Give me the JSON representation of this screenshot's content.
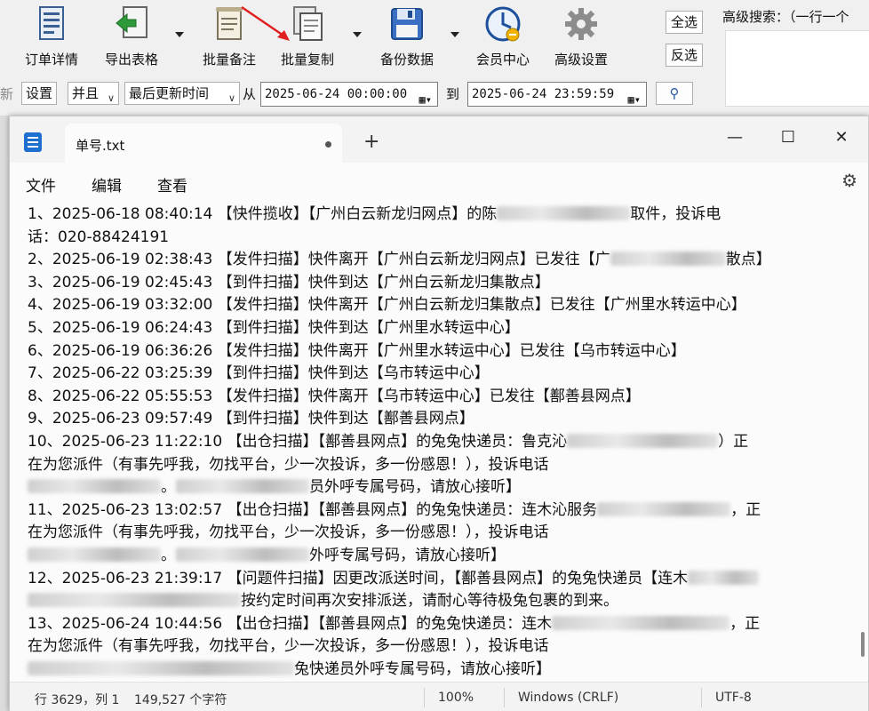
{
  "toolbar": {
    "buttons": [
      {
        "label": "订单详情",
        "icon": "order-detail-icon"
      },
      {
        "label": "导出表格",
        "icon": "export-table-icon"
      },
      {
        "label": "批量备注",
        "icon": "batch-note-icon"
      },
      {
        "label": "批量复制",
        "icon": "batch-copy-icon"
      },
      {
        "label": "备份数据",
        "icon": "backup-disk-icon"
      },
      {
        "label": "会员中心",
        "icon": "member-clock-icon"
      },
      {
        "label": "高级设置",
        "icon": "gear-icon"
      }
    ],
    "select_all": "全选",
    "invert": "反选",
    "advanced_search_label": "高级搜索：（一行一个"
  },
  "filter": {
    "left_fragment": "新",
    "settings": "设置",
    "logic": "并且",
    "field": "最后更新时间",
    "from_label": "从",
    "from_value": "2025-06-24 00:00:00",
    "to_label": "到",
    "to_value": "2025-06-24 23:59:59"
  },
  "notepad": {
    "tab_title": "单号.txt",
    "new_tab": "+",
    "menu": [
      "文件",
      "编辑",
      "查看"
    ],
    "lines": [
      {
        "pre": "1、2025-06-18 08:40:14 【快件揽收】【广州白云新龙归网点】的陈",
        "blur": 150,
        "post": "取件，投诉电"
      },
      {
        "pre": "话：020-88424191",
        "blur": 0,
        "post": ""
      },
      {
        "pre": "2、2025-06-19 02:38:43 【发件扫描】快件离开【广州白云新龙归网点】已发往【广",
        "blur": 130,
        "post": "散点】"
      },
      {
        "pre": "3、2025-06-19 02:45:43 【到件扫描】快件到达【广州白云新龙归集散点】",
        "blur": 0,
        "post": ""
      },
      {
        "pre": "4、2025-06-19 03:32:00 【发件扫描】快件离开【广州白云新龙归集散点】已发往【广州里水转运中心】",
        "blur": 0,
        "post": ""
      },
      {
        "pre": "5、2025-06-19 06:24:43 【到件扫描】快件到达【广州里水转运中心】",
        "blur": 0,
        "post": ""
      },
      {
        "pre": "6、2025-06-19 06:36:26 【发件扫描】快件离开【广州里水转运中心】已发往【乌市转运中心】",
        "blur": 0,
        "post": ""
      },
      {
        "pre": "7、2025-06-22 03:25:39 【到件扫描】快件到达【乌市转运中心】",
        "blur": 0,
        "post": ""
      },
      {
        "pre": "8、2025-06-22 05:55:53 【发件扫描】快件离开【乌市转运中心】已发往【鄯善县网点】",
        "blur": 0,
        "post": ""
      },
      {
        "pre": "9、2025-06-23 09:57:49 【到件扫描】快件到达【鄯善县网点】",
        "blur": 0,
        "post": ""
      },
      {
        "pre": "10、2025-06-23 11:22:10 【出仓扫描】【鄯善县网点】的兔兔快递员：鲁克沁",
        "blur": 170,
        "post": "）正"
      },
      {
        "pre": "在为您派件（有事先呼我，勿找平台，少一次投诉，多一份感恩！），投诉电话",
        "blur": 0,
        "post": ""
      },
      {
        "pre": "",
        "blur": 150,
        "post": "。",
        "blur2": 150,
        "post2": "员外呼专属号码，请放心接听】"
      },
      {
        "pre": "11、2025-06-23 13:02:57 【出仓扫描】【鄯善县网点】的兔兔快递员：连木沁服务",
        "blur": 150,
        "post": "，正"
      },
      {
        "pre": "在为您派件（有事先呼我，勿找平台，少一次投诉，多一份感恩！），投诉电话",
        "blur": 0,
        "post": ""
      },
      {
        "pre": "",
        "blur": 150,
        "post": "。",
        "blur2": 150,
        "post2": "外呼专属号码，请放心接听】"
      },
      {
        "pre": "12、2025-06-23 21:39:17 【问题件扫描】因更改派送时间，【鄯善县网点】的兔兔快递员【连木",
        "blur": 80,
        "post": ""
      },
      {
        "pre": "",
        "blur": 240,
        "post": "按约定时间再次安排派送，请耐心等待极兔包裹的到来。"
      },
      {
        "pre": "13、2025-06-24 10:44:56 【出仓扫描】【鄯善县网点】的兔兔快递员：连木",
        "blur": 200,
        "post": "，正"
      },
      {
        "pre": "在为您派件（有事先呼我，勿找平台，少一次投诉，多一份感恩！），投诉电话",
        "blur": 0,
        "post": ""
      },
      {
        "pre": "",
        "blur": 300,
        "post": "兔快递员外呼专属号码，请放心接听】"
      }
    ]
  },
  "status": {
    "position": "行 3629，列 1",
    "chars": "149,527 个字符",
    "zoom": "100%",
    "eol": "Windows (CRLF)",
    "encoding": "UTF-8"
  }
}
